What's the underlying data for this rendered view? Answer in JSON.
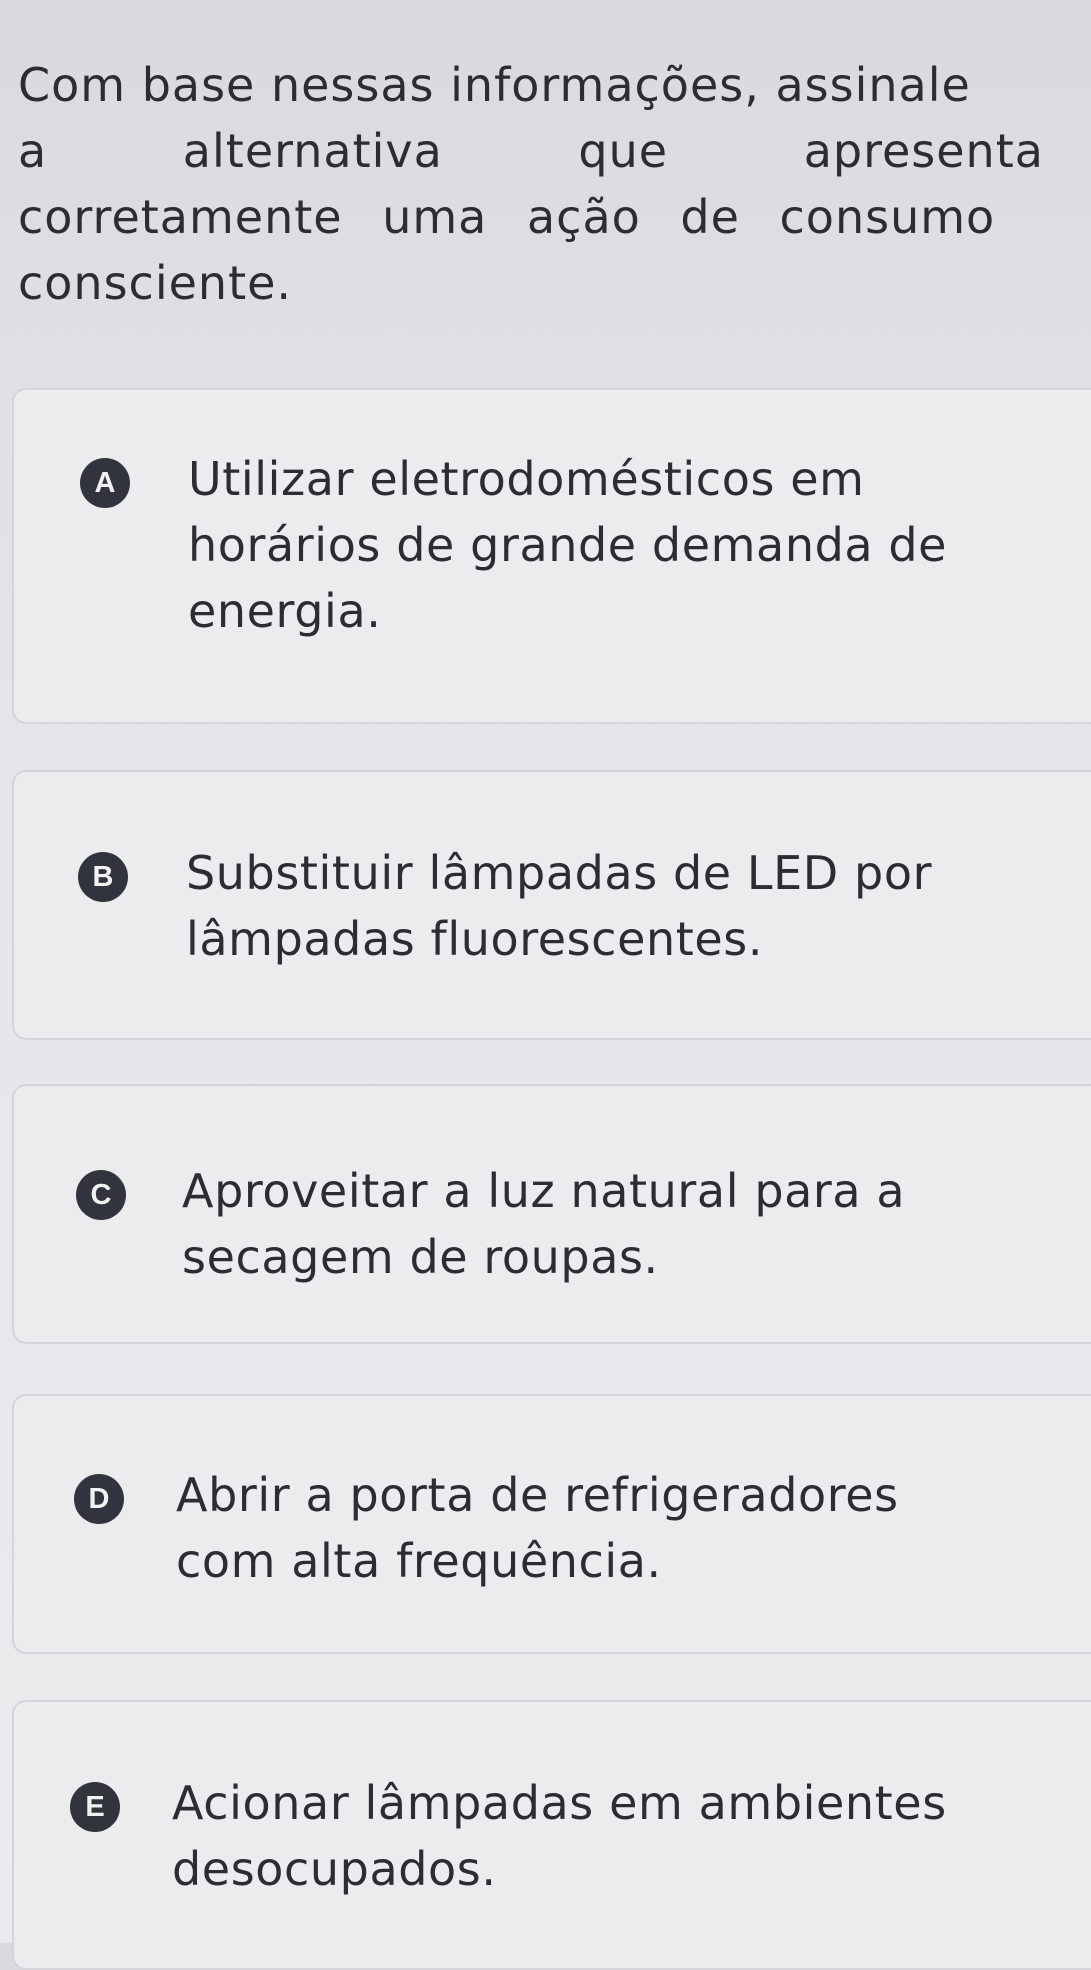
{
  "question": {
    "lines": [
      "Com base nessas informações, assinale",
      "a alternativa que apresenta",
      "corretamente uma ação de consumo",
      "consciente."
    ]
  },
  "options": [
    {
      "letter": "A",
      "lines": [
        "Utilizar eletrodomésticos em",
        "horários de grande demanda de",
        "energia."
      ]
    },
    {
      "letter": "B",
      "lines": [
        "Substituir lâmpadas de LED por",
        "lâmpadas fluorescentes."
      ]
    },
    {
      "letter": "C",
      "lines": [
        "Aproveitar a luz natural para a",
        "secagem de roupas."
      ]
    },
    {
      "letter": "D",
      "lines": [
        "Abrir a porta de refrigeradores",
        "com alta frequência."
      ]
    },
    {
      "letter": "E",
      "lines": [
        "Acionar lâmpadas em ambientes",
        "desocupados."
      ]
    }
  ]
}
